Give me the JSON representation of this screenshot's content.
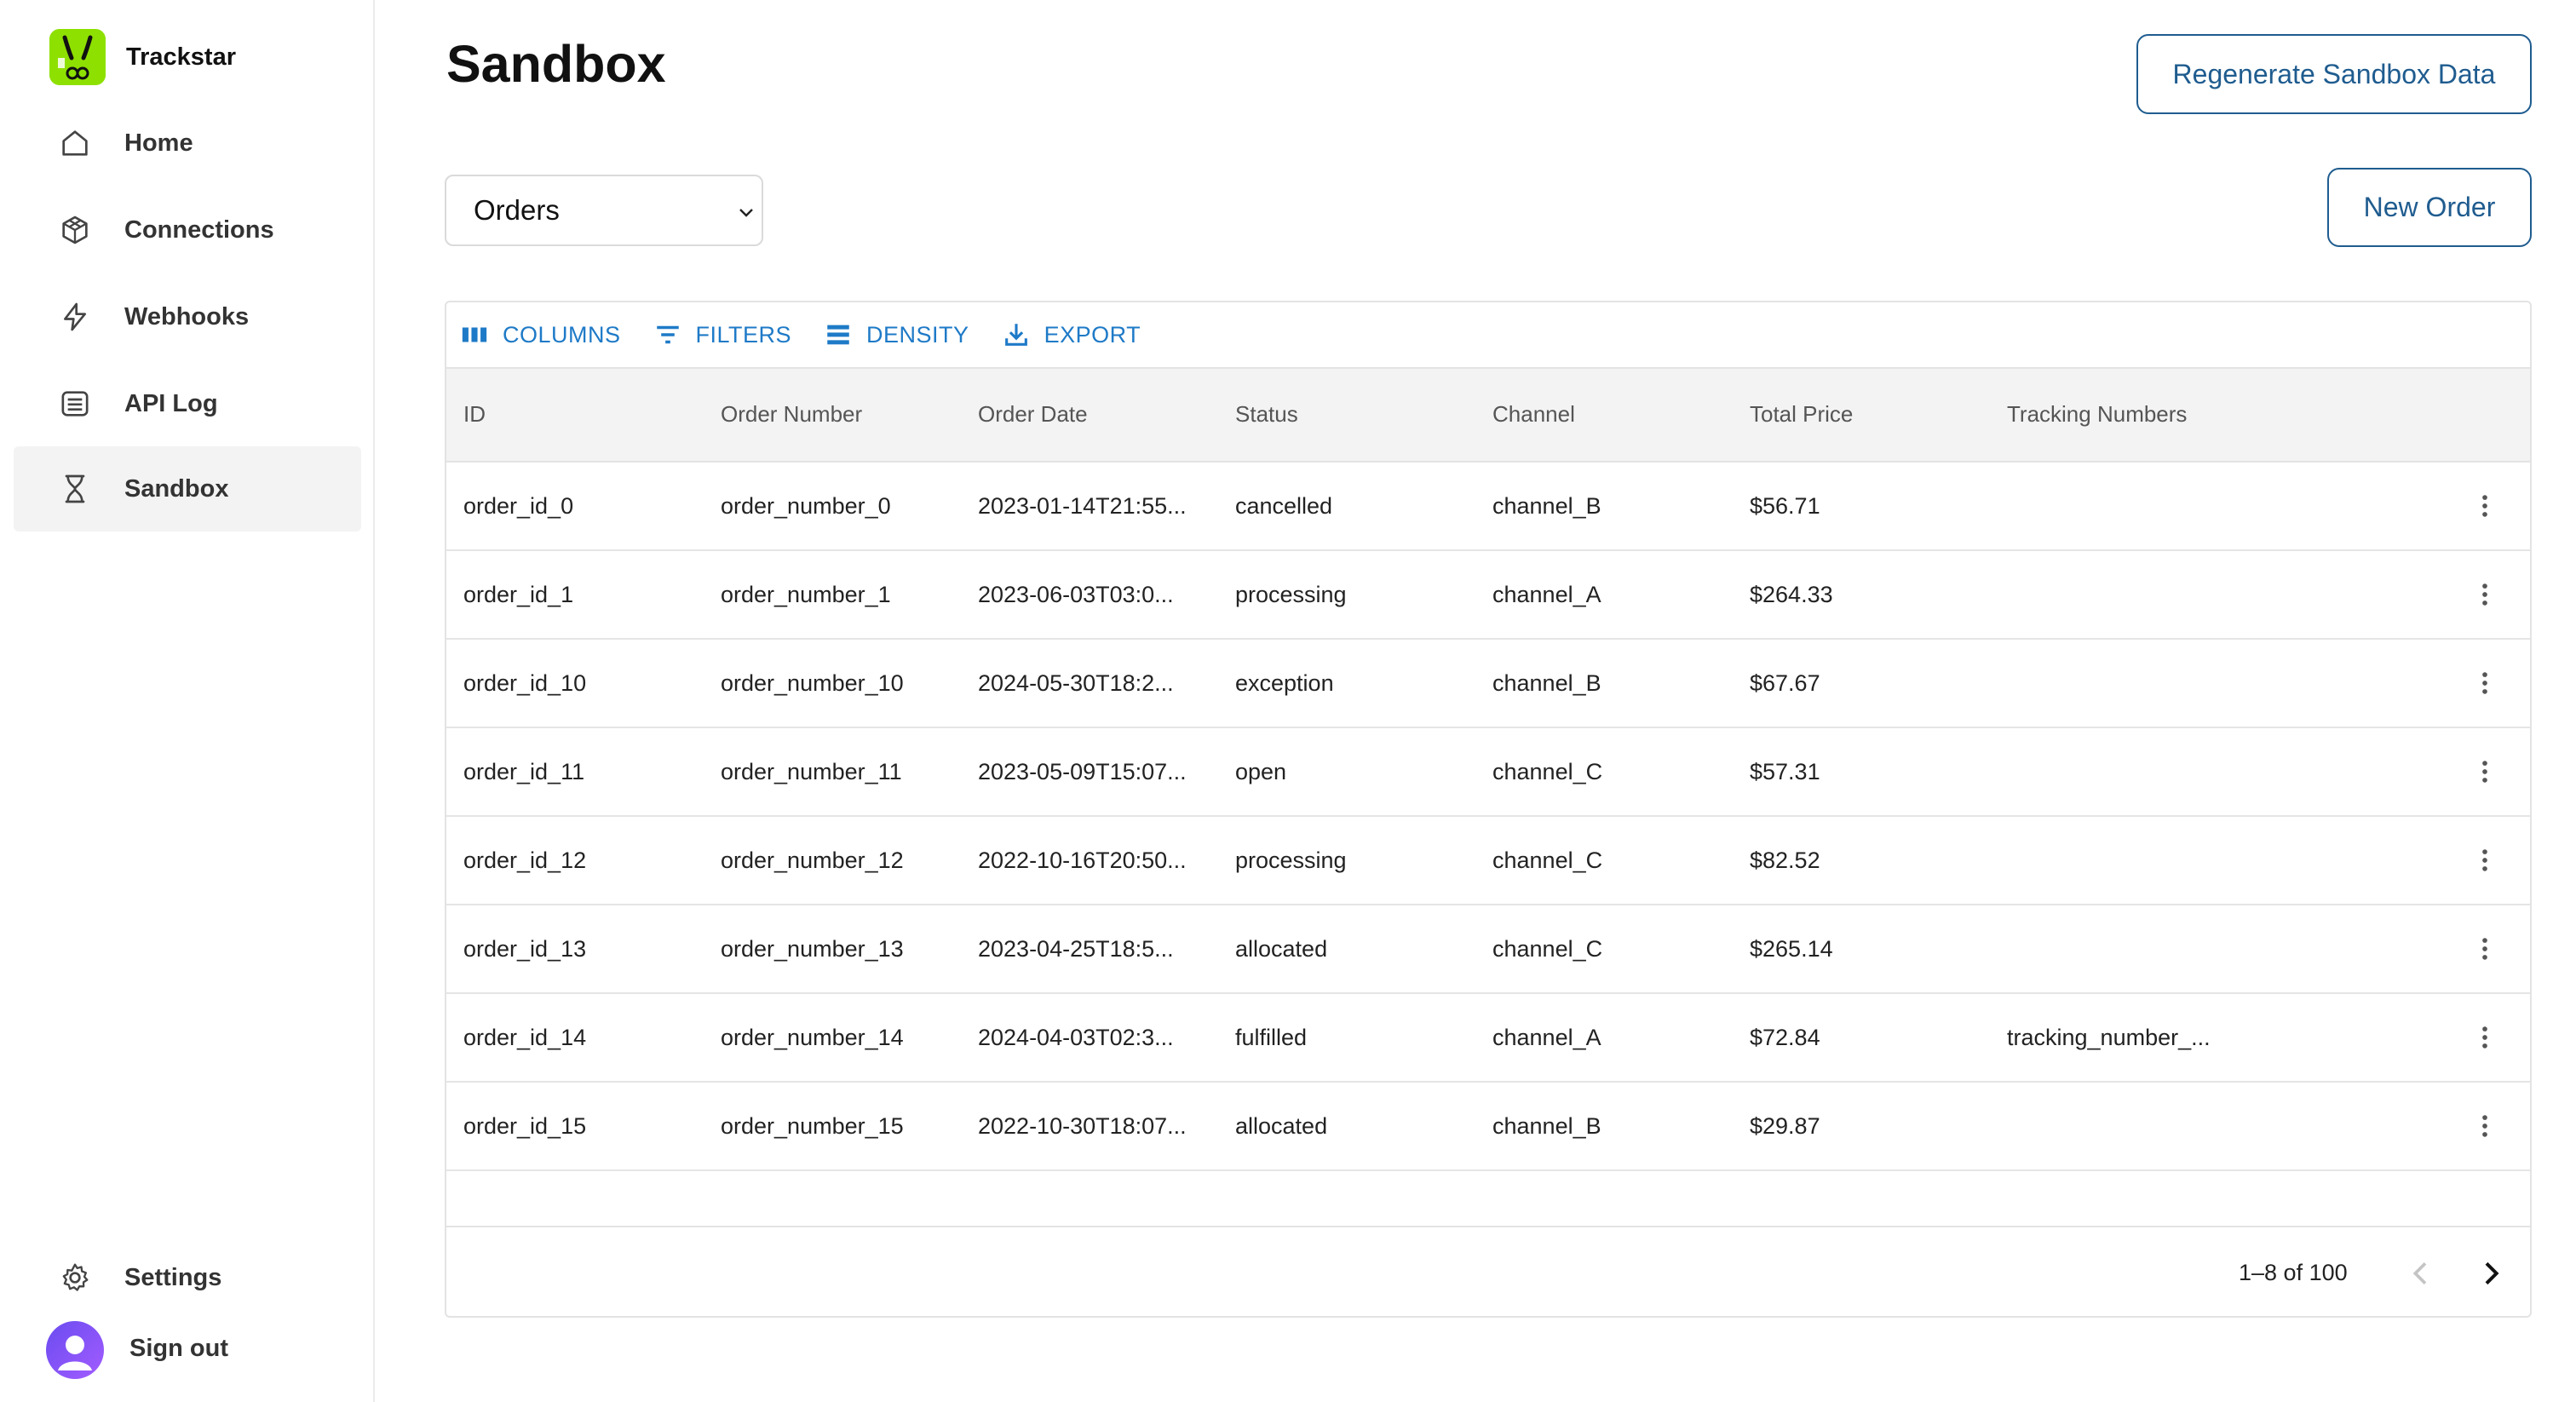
{
  "brand": {
    "name": "Trackstar"
  },
  "sidebar": {
    "items": [
      {
        "label": "Home",
        "icon": "home-icon"
      },
      {
        "label": "Connections",
        "icon": "cube-icon"
      },
      {
        "label": "Webhooks",
        "icon": "lightning-icon"
      },
      {
        "label": "API Log",
        "icon": "list-icon"
      },
      {
        "label": "Sandbox",
        "icon": "hourglass-icon",
        "active": true
      }
    ],
    "settings_label": "Settings",
    "signout_label": "Sign out"
  },
  "header": {
    "title": "Sandbox",
    "regenerate_label": "Regenerate Sandbox Data",
    "new_label": "New Order",
    "select_value": "Orders"
  },
  "toolbar": {
    "columns_label": "COLUMNS",
    "filters_label": "FILTERS",
    "density_label": "DENSITY",
    "export_label": "EXPORT"
  },
  "table": {
    "columns": [
      "ID",
      "Order Number",
      "Order Date",
      "Status",
      "Channel",
      "Total Price",
      "Tracking Numbers"
    ],
    "rows": [
      [
        "order_id_0",
        "order_number_0",
        "2023-01-14T21:55...",
        "cancelled",
        "channel_B",
        "$56.71",
        ""
      ],
      [
        "order_id_1",
        "order_number_1",
        "2023-06-03T03:0...",
        "processing",
        "channel_A",
        "$264.33",
        ""
      ],
      [
        "order_id_10",
        "order_number_10",
        "2024-05-30T18:2...",
        "exception",
        "channel_B",
        "$67.67",
        ""
      ],
      [
        "order_id_11",
        "order_number_11",
        "2023-05-09T15:07...",
        "open",
        "channel_C",
        "$57.31",
        ""
      ],
      [
        "order_id_12",
        "order_number_12",
        "2022-10-16T20:50...",
        "processing",
        "channel_C",
        "$82.52",
        ""
      ],
      [
        "order_id_13",
        "order_number_13",
        "2023-04-25T18:5...",
        "allocated",
        "channel_C",
        "$265.14",
        ""
      ],
      [
        "order_id_14",
        "order_number_14",
        "2024-04-03T02:3...",
        "fulfilled",
        "channel_A",
        "$72.84",
        "tracking_number_..."
      ],
      [
        "order_id_15",
        "order_number_15",
        "2022-10-30T18:07...",
        "allocated",
        "channel_B",
        "$29.87",
        ""
      ]
    ]
  },
  "pagination": {
    "text": "1–8 of 100"
  },
  "colors": {
    "accent": "#1e7ac7",
    "button_border": "#1f5c8f",
    "brand_green": "#8ee000",
    "active_bg": "#f3f3f3"
  }
}
